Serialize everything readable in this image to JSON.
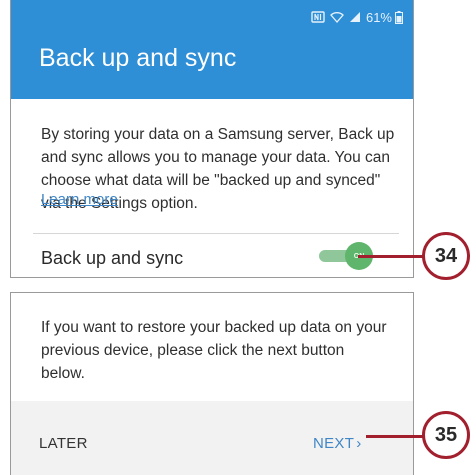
{
  "status_bar": {
    "battery_text": "61%",
    "icons": [
      "nfc-icon",
      "wifi-icon",
      "signal-icon",
      "battery-icon"
    ]
  },
  "header": {
    "title": "Back up and sync",
    "color": "#2e8ed6"
  },
  "main": {
    "description": "By storing your data on a Samsung server, Back up and sync allows you to manage your data. You can choose what data will be \"backed up and synced\" via the Settings option.",
    "learn_more": "Learn more",
    "sync_label": "Back up and sync",
    "toggle": {
      "state": "ON",
      "on": true,
      "color": "#5fb56b"
    }
  },
  "restore": {
    "text": "If you want to restore your backed up data on your previous device, please click the next button below.",
    "later_label": "LATER",
    "next_label": "NEXT"
  },
  "callouts": [
    {
      "number": "34"
    },
    {
      "number": "35"
    }
  ]
}
